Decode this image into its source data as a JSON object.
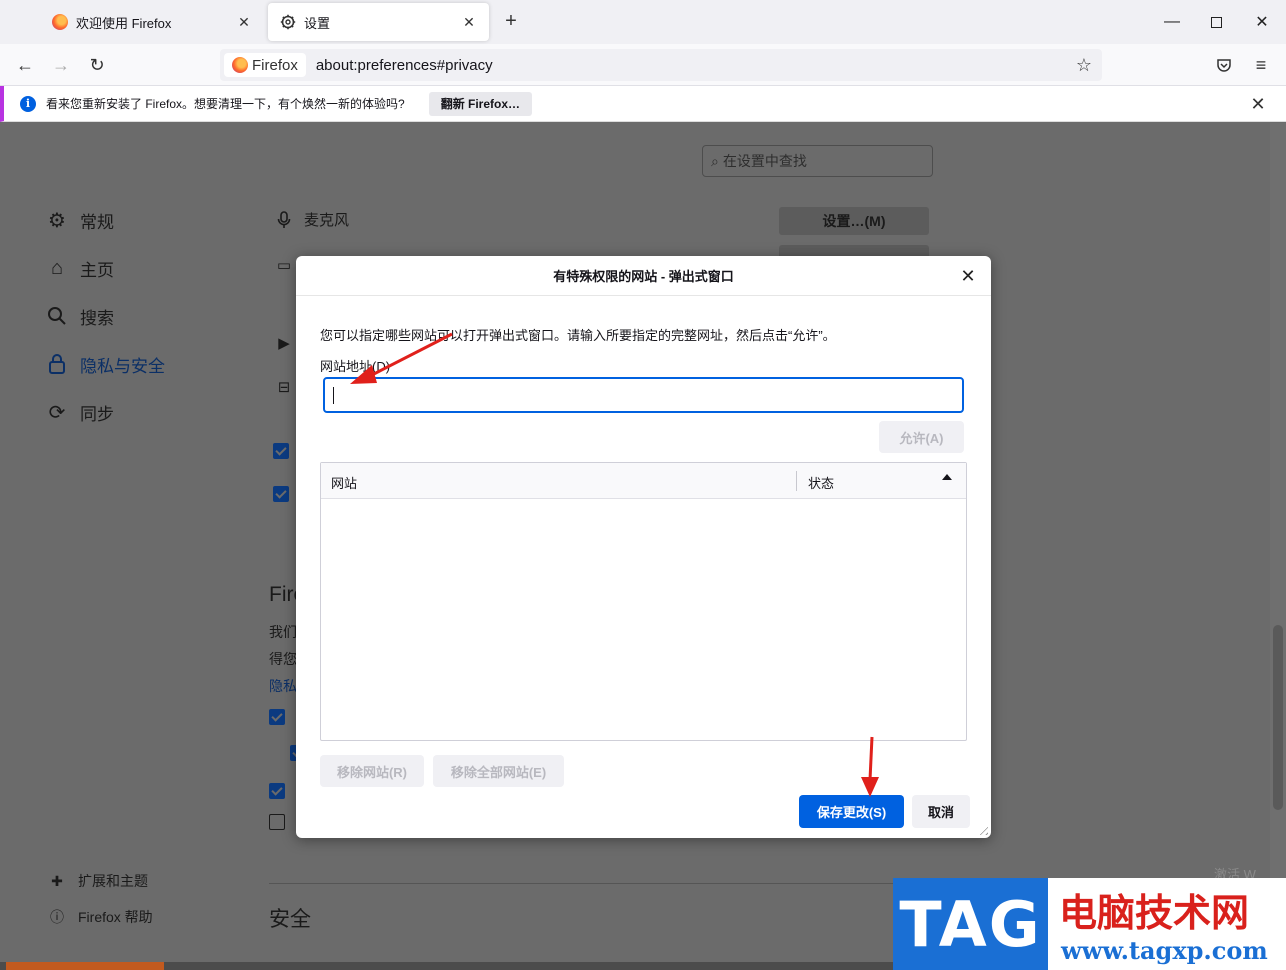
{
  "tabs": [
    {
      "title": "欢迎使用 Firefox",
      "icon": "firefox-logo-icon",
      "active": false
    },
    {
      "title": "设置",
      "icon": "gear-icon",
      "active": true
    }
  ],
  "navbar": {
    "identity_label": "Firefox",
    "url": "about:preferences#privacy"
  },
  "notification": {
    "text": "看来您重新安装了 Firefox。想要清理一下，有个焕然一新的体验吗?",
    "button_label": "翻新 Firefox…"
  },
  "preferences": {
    "search_placeholder": "在设置中查找",
    "categories": [
      {
        "label": "常规",
        "icon": "gear-icon"
      },
      {
        "label": "主页",
        "icon": "home-icon"
      },
      {
        "label": "搜索",
        "icon": "search-icon"
      },
      {
        "label": "隐私与安全",
        "icon": "lock-icon",
        "selected": true
      },
      {
        "label": "同步",
        "icon": "sync-icon"
      }
    ],
    "footer_links": [
      {
        "label": "扩展和主题",
        "icon": "puzzle-icon"
      },
      {
        "label": "Firefox 帮助",
        "icon": "help-icon"
      }
    ],
    "permission_microphone": "麦克风",
    "settings_button": "设置…(M)",
    "section_partial": "Fire",
    "text_partial_1": "我们",
    "text_partial_2": "得您",
    "link_partial": "隐私",
    "security_heading": "安全"
  },
  "dialog": {
    "title": "有特殊权限的网站 - 弹出式窗口",
    "description": "您可以指定哪些网站可以打开弹出式窗口。请输入所要指定的完整网址，然后点击“允许”。",
    "address_label": "网站地址(D)",
    "address_value": "",
    "allow_button": "允许(A)",
    "columns": {
      "site": "网站",
      "status": "状态"
    },
    "remove_button": "移除网站(R)",
    "remove_all_button": "移除全部网站(E)",
    "save_button": "保存更改(S)",
    "cancel_button": "取消"
  },
  "watermark": {
    "tag": "TAG",
    "name": "电脑技术网",
    "url": "www.tagxp.com"
  },
  "os_overlay": "激活 W",
  "colors": {
    "accent": "#0061e0",
    "annotation_arrow": "#e0201b",
    "notification_border": "#b833e1"
  }
}
